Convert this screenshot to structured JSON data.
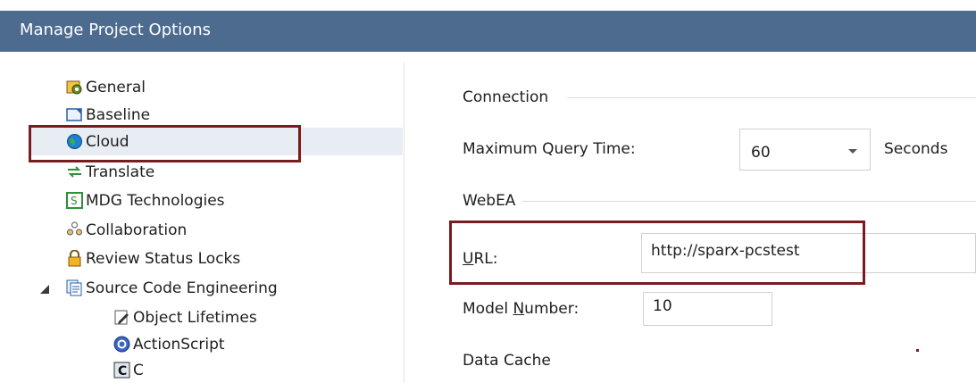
{
  "window": {
    "title": "Manage Project Options"
  },
  "tree": {
    "items": [
      {
        "label": "General",
        "icon": "gear-folder-icon"
      },
      {
        "label": "Baseline",
        "icon": "baseline-icon"
      },
      {
        "label": "Cloud",
        "icon": "globe-icon",
        "selected": true
      },
      {
        "label": "Translate",
        "icon": "translate-arrows-icon"
      },
      {
        "label": "MDG Technologies",
        "icon": "mdg-icon"
      },
      {
        "label": "Collaboration",
        "icon": "people-icon"
      },
      {
        "label": "Review Status Locks",
        "icon": "padlock-icon"
      },
      {
        "label": "Source Code Engineering",
        "icon": "code-pages-icon",
        "expanded": true
      },
      {
        "label": "Object Lifetimes",
        "icon": "pencil-page-icon"
      },
      {
        "label": "ActionScript",
        "icon": "actionscript-icon"
      },
      {
        "label": "C",
        "icon": "c-language-icon"
      }
    ]
  },
  "panel": {
    "connection_heading": "Connection",
    "max_query_label": "Maximum Query Time:",
    "max_query_value": "60",
    "seconds_label": "Seconds",
    "webea_heading": "WebEA",
    "url_label": "URL:",
    "url_label_rest": "RL:",
    "url_label_accel": "U",
    "url_value": "http://sparx-pcstest",
    "model_number_label_pre": "Model ",
    "model_number_label_accel": "N",
    "model_number_label_post": "umber:",
    "model_number_value": "10",
    "data_cache_heading": "Data Cache"
  },
  "colors": {
    "titlebar": "#4d6a8f",
    "highlight": "#7a1b20",
    "selection": "#e8edf3"
  }
}
